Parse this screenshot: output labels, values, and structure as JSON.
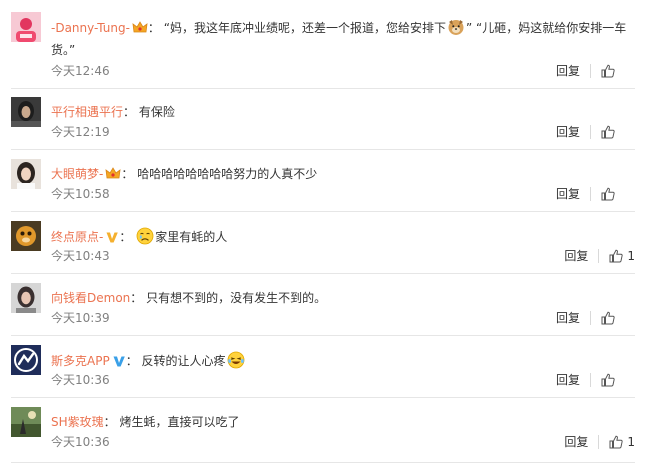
{
  "time_prefix": "今天",
  "reply_label": "回复",
  "colors": {
    "username": "#eb7350",
    "vip_blue": "#3aa0e8",
    "text": "#333333",
    "meta": "#808080"
  },
  "comments": [
    {
      "user": "-Danny-Tung-",
      "badge": "crown-icon",
      "colon": "：",
      "text_a": "“妈，我这年底冲业绩呢，还差一个报道，您给安排下",
      "text_b": "” “儿砸，妈这就给你安排一车货。”",
      "emoji": "dog-face-icon",
      "time": "今天12:46",
      "likes": ""
    },
    {
      "user": "平行相遇平行",
      "badge": "",
      "colon": "：",
      "text": "有保险",
      "time": "今天12:19",
      "likes": ""
    },
    {
      "user": "大眼萌梦-",
      "badge": "crown-icon",
      "colon": "：",
      "text": "哈哈哈哈哈哈哈哈努力的人真不少",
      "time": "今天10:58",
      "likes": ""
    },
    {
      "user": "终点原点-",
      "badge": "vip-v-icon",
      "colon": "：",
      "emoji": "sad-face-icon",
      "text": "家里有蚝的人",
      "time": "今天10:43",
      "likes": "1"
    },
    {
      "user": "向钱看Demon",
      "badge": "",
      "colon": "：",
      "text": "只有想不到的，没有发生不到的。",
      "time": "今天10:39",
      "likes": ""
    },
    {
      "user": "斯多克APP",
      "badge": "vip-v-icon",
      "colon": "：",
      "text": "反转的让人心疼",
      "emoji": "laughing-tears-icon",
      "time": "今天10:36",
      "likes": ""
    },
    {
      "user": "SH紫玫瑰",
      "badge": "",
      "colon": "：",
      "text": "烤生蚝，直接可以吃了",
      "time": "今天10:36",
      "likes": "1"
    }
  ]
}
